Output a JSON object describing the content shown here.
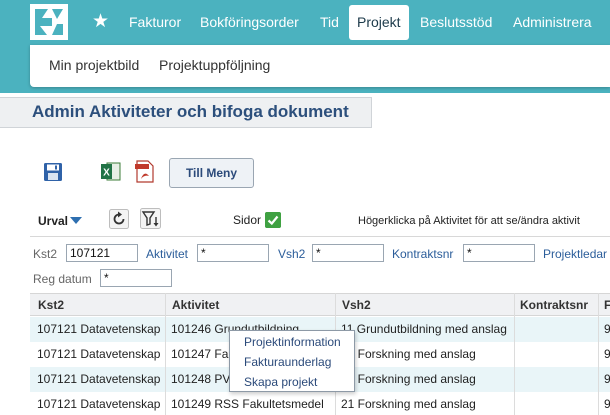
{
  "nav": {
    "items": [
      {
        "label": "Fakturor"
      },
      {
        "label": "Bokföringsorder"
      },
      {
        "label": "Tid"
      },
      {
        "label": "Projekt",
        "active": true
      },
      {
        "label": "Beslutsstöd"
      },
      {
        "label": "Administrera"
      }
    ],
    "star_icon": "star-icon",
    "logo_icon": "logo-icon"
  },
  "subnav": {
    "items": [
      {
        "label": "Min projektbild"
      },
      {
        "label": "Projektuppföljning"
      }
    ]
  },
  "page": {
    "title": "Admin Aktiviteter och bifoga dokument"
  },
  "toolbar": {
    "icons": [
      "save-icon",
      "excel-icon",
      "pdf-icon"
    ],
    "menu_button": "Till Meny"
  },
  "filterbar": {
    "urval": "Urval",
    "sidor": "Sidor",
    "sidor_checked": true,
    "hint": "Högerklicka på Aktivitet för att se/ändra aktivit"
  },
  "filters": {
    "kst2": {
      "label": "Kst2",
      "value": "107121"
    },
    "aktivitet": {
      "label": "Aktivitet",
      "value": "*"
    },
    "vsh2": {
      "label": "Vsh2",
      "value": "*"
    },
    "kontraktsnr": {
      "label": "Kontraktsnr",
      "value": "*"
    },
    "projektledare": {
      "label": "Projektledar"
    },
    "regdatum": {
      "label": "Reg datum",
      "value": "*"
    }
  },
  "table": {
    "columns": [
      "Kst2",
      "Aktivitet",
      "Vsh2",
      "Kontraktsnr",
      "F"
    ],
    "rows": [
      {
        "kst2": "107121 Datavetenskap",
        "aktivitet": "101246 Grundutbildning",
        "vsh2": "11 Grundutbildning med anslag",
        "kontraktsnr": "",
        "f": "9"
      },
      {
        "kst2": "107121 Datavetenskap",
        "aktivitet": "101247 Fa",
        "vsh2": "21 Forskning med anslag",
        "kontraktsnr": "",
        "f": "9"
      },
      {
        "kst2": "107121 Datavetenskap",
        "aktivitet": "101248 PV",
        "vsh2": "21 Forskning med anslag",
        "kontraktsnr": "",
        "f": "9"
      },
      {
        "kst2": "107121 Datavetenskap",
        "aktivitet": "101249 RSS Fakultetsmedel",
        "vsh2": "21 Forskning med anslag",
        "kontraktsnr": "",
        "f": "9"
      }
    ]
  },
  "context_menu": {
    "items": [
      "Projektinformation",
      "Fakturaunderlag",
      "Skapa projekt"
    ]
  },
  "colors": {
    "nav_bg": "#4bb2bf",
    "title_text": "#2c4f7c",
    "link": "#2b5d9a",
    "row_alt": "#e9f5f8",
    "check_green": "#3fa142"
  }
}
